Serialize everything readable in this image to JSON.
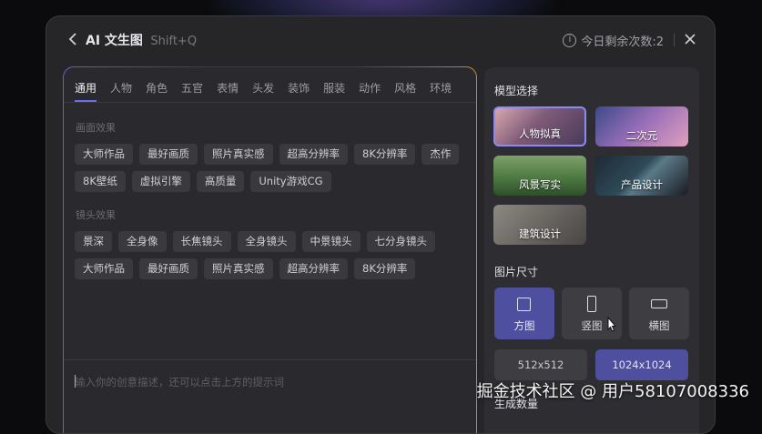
{
  "header": {
    "app_title": "AI 文生图",
    "shortcut": "Shift+Q",
    "quota_text": "今日剩余次数:2"
  },
  "tabs": [
    "通用",
    "人物",
    "角色",
    "五官",
    "表情",
    "头发",
    "装饰",
    "服装",
    "动作",
    "风格",
    "环境"
  ],
  "section_picture": {
    "title": "画面效果",
    "chips": [
      "大师作品",
      "最好画质",
      "照片真实感",
      "超高分辨率",
      "8K分辨率",
      "杰作",
      "8K壁纸",
      "虚拟引擎",
      "高质量",
      "Unity游戏CG"
    ]
  },
  "section_lens": {
    "title": "镜头效果",
    "chips": [
      "景深",
      "全身像",
      "长焦镜头",
      "全身镜头",
      "中景镜头",
      "七分身镜头",
      "大师作品",
      "最好画质",
      "照片真实感",
      "超高分辨率",
      "8K分辨率"
    ]
  },
  "prompt": {
    "placeholder": "输入你的创意描述，还可以点击上方的提示词"
  },
  "model": {
    "title": "模型选择",
    "options": [
      "人物拟真",
      "二次元",
      "风景写实",
      "产品设计",
      "建筑设计"
    ],
    "selected": "人物拟真"
  },
  "size": {
    "title": "图片尺寸",
    "options": [
      "方图",
      "竖图",
      "横图"
    ],
    "selected": "方图"
  },
  "resolution": {
    "options": [
      "512x512",
      "1024x1024"
    ],
    "selected": "1024x1024"
  },
  "count_title": "生成数量",
  "watermark": "掘金技术社区 @ 用户58107008336",
  "colors": {
    "accent": "#4e4f9e",
    "background": "#262629"
  }
}
